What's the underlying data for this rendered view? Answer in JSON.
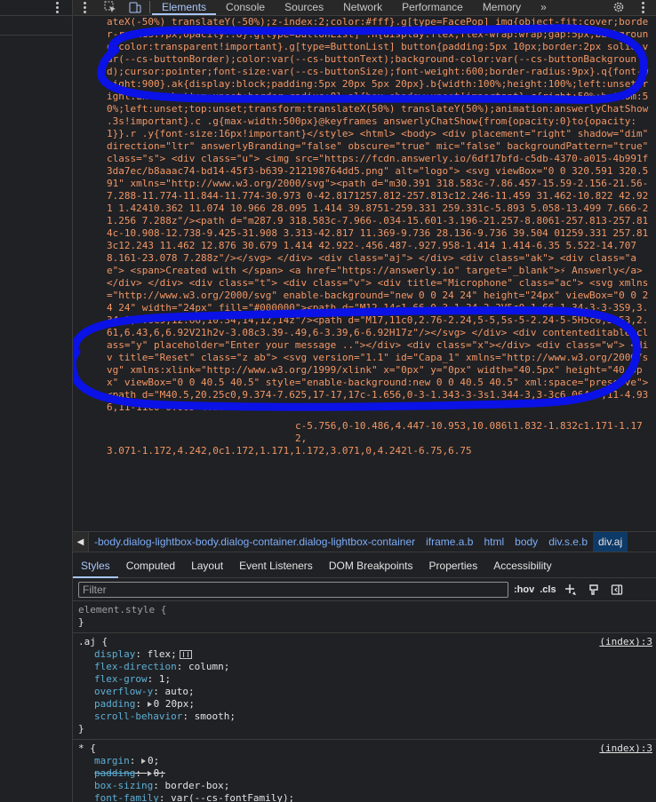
{
  "toolbar": {
    "tabs": [
      "Elements",
      "Console",
      "Sources",
      "Network",
      "Performance",
      "Memory"
    ],
    "more": "»"
  },
  "code": {
    "text": "ateX(-50%) translateY(-50%);z-index:2;color:#fff}.g[type=FacePop] img{object-fit:cover;border-radius:7px;opacity:.8}.g[type=ButtonList] .h{display:flex;flex-wrap:wrap;gap:5px;background-color:transparent!important}.g[type=ButtonList] button{padding:5px 10px;border:2px solid var(--cs-buttonBorder);color:var(--cs-buttonText);background-color:var(--cs-buttonBackground);cursor:pointer;font-size:var(--cs-buttonSize);font-weight:600;border-radius:9px}.q{font-weight:900}.ak{display:block;padding:5px 20px 5px 20px}.b{width:100%;height:100%;left:unset;right:unset;bottom:unset;border-radius:0}.al{box-shadow:unset!important}.c{right:50%;bottom:50%;left:unset;top:unset;transform:translateX(50%) translateY(50%);animation:answerlyChatShow .3s!important}.c .g{max-width:500px}@keyframes answerlyChatShow{from{opacity:0}to{opacity:1}}.r .y{font-size:16px!important}</style> <html> <body> <div placement=\"right\" shadow=\"dim\" direction=\"ltr\" answerlyBranding=\"false\" obscure=\"true\" mic=\"false\" backgroundPattern=\"true\" class=\"s\"> <div class=\"u\"> <img src=\"https://fcdn.answerly.io/6df17bfd-c5db-4370-a015-4b991f3da7ec/b8aaac74-bd14-45f3-b639-212198764dd5.png\" alt=\"logo\"> <svg viewBox=\"0 0 320.591 320.591\" xmlns=\"http://www.w3.org/2000/svg\"><path d=\"m30.391 318.583c-7.86.457-15.59-2.156-21.56-7.288-11.774-11.844-11.774-30.973 0-42.8171257.812-257.813c12.246-11.459 31.462-10.822 42.921 1.42410.362 11.074 10.966 28.095 1.414 39.8751-259.331 259.331c-5.893 5.058-13.499 7.666-21.256 7.288z\"/><path d=\"m287.9 318.583c-7.966-.034-15.601-3.196-21.257-8.8061-257.813-257.814c-10.908-12.738-9.425-31.908 3.313-42.817 11.369-9.736 28.136-9.736 39.504 01259.331 257.813c12.243 11.462 12.876 30.679 1.414 42.922-.456.487-.927.958-1.414 1.414-6.35 5.522-14.707 8.161-23.078 7.288z\"/></svg> </div> <div class=\"aj\"> </div> <div class=\"ak\"> <div class=\"ae\"> <span>Created with </span> <a href=\"https://answerly.io\" target=\"_blank\">⚡ Answerly</a> </div> </div> <div class=\"t\"> <div class=\"v\"> <div title=\"Microphone\" class=\"ac\"> <svg xmlns=\"http://www.w3.org/2000/svg\" enable-background=\"new 0 0 24 24\" height=\"24px\" viewBox=\"0 0 24 24\" width=\"24px\" fill=\"#000000\"><path d=\"M12,14c1.66,0,3-1.34,3-3V5c0-1.66-1.34-3-3-3S9,3.34,9,5v6C9,12.66,10.34,14,12,14z\"/><path d=\"M17,11c0,2.76-2.24,5-5,5s-5-2.24-5-5H5c0,3.53,2.61,6.43,6,6.92V21h2v-3.08c3.39-.49,6-3.39,6-6.92H17z\"/></svg> </div> <div contenteditable class=\"y\" placeholder=\"Enter your message ..\"></div> <div class=\"x\"></div> <div class=\"w\"> <div title=\"Reset\" class=\"z ab\"> <svg version=\"1.1\" id=\"Capa_1\" xmlns=\"http://www.w3.org/2000/svg\" xmlns:xlink=\"http://www.w3.org/1999/xlink\" x=\"0px\" y=\"0px\" width=\"40.5px\" height=\"40.5px\" viewBox=\"0 0 40.5 40.5\" style=\"enable-background:new 0 0 40.5 40.5\" xml:space=\"preserve\"> <path d=\"M40.5,20.25c0,9.374-7.625,17-17,17c-1.656,0-3-1.343-3-3s1.344-3,3-3c6.064,0,11-4.936,11-11c0-6.065-4.936-11-11-11",
    "tail_line_1": "c-5.756,0-10.486,4.447-10.953,10.086l1.832-1.832c1.171-1.172,",
    "tail_line_2": "3.071-1.172,4.242,0c1.172,1.171,1.172,3.071,0,4.242l-6.75,6.75"
  },
  "breadcrumb": {
    "items": [
      "-body.dialog-lightbox-body.dialog-container.dialog-lightbox-container",
      "iframe.a.b",
      "html",
      "body",
      "div.s.e.b",
      "div.aj"
    ]
  },
  "subtabs": [
    "Styles",
    "Computed",
    "Layout",
    "Event Listeners",
    "DOM Breakpoints",
    "Properties",
    "Accessibility"
  ],
  "filter": {
    "placeholder": "Filter",
    "hov": ":hov",
    "cls": ".cls"
  },
  "styles": {
    "element_style": {
      "selector": "element.style {",
      "close": "}"
    },
    "rule_aj": {
      "selector": ".aj {",
      "source": "(index):3",
      "decls": [
        {
          "prop": "display",
          "val": "flex;"
        },
        {
          "prop": "flex-direction",
          "val": "column;"
        },
        {
          "prop": "flex-grow",
          "val": "1;"
        },
        {
          "prop": "overflow-y",
          "val": "auto;"
        },
        {
          "prop": "padding",
          "val": "0 20px;"
        },
        {
          "prop": "scroll-behavior",
          "val": "smooth;"
        }
      ],
      "close": "}"
    },
    "rule_star": {
      "selector": "* {",
      "source": "(index):3",
      "decls": [
        {
          "prop": "margin",
          "val": "0;"
        },
        {
          "prop": "padding",
          "val": "0;"
        },
        {
          "prop": "box-sizing",
          "val": "border-box;"
        },
        {
          "prop": "font-family",
          "val": "var(--cs-fontFamily);"
        }
      ]
    }
  },
  "colors": {
    "ink": "#0a12e6",
    "accent": "#a8c7fa",
    "code_text": "#f29766"
  }
}
